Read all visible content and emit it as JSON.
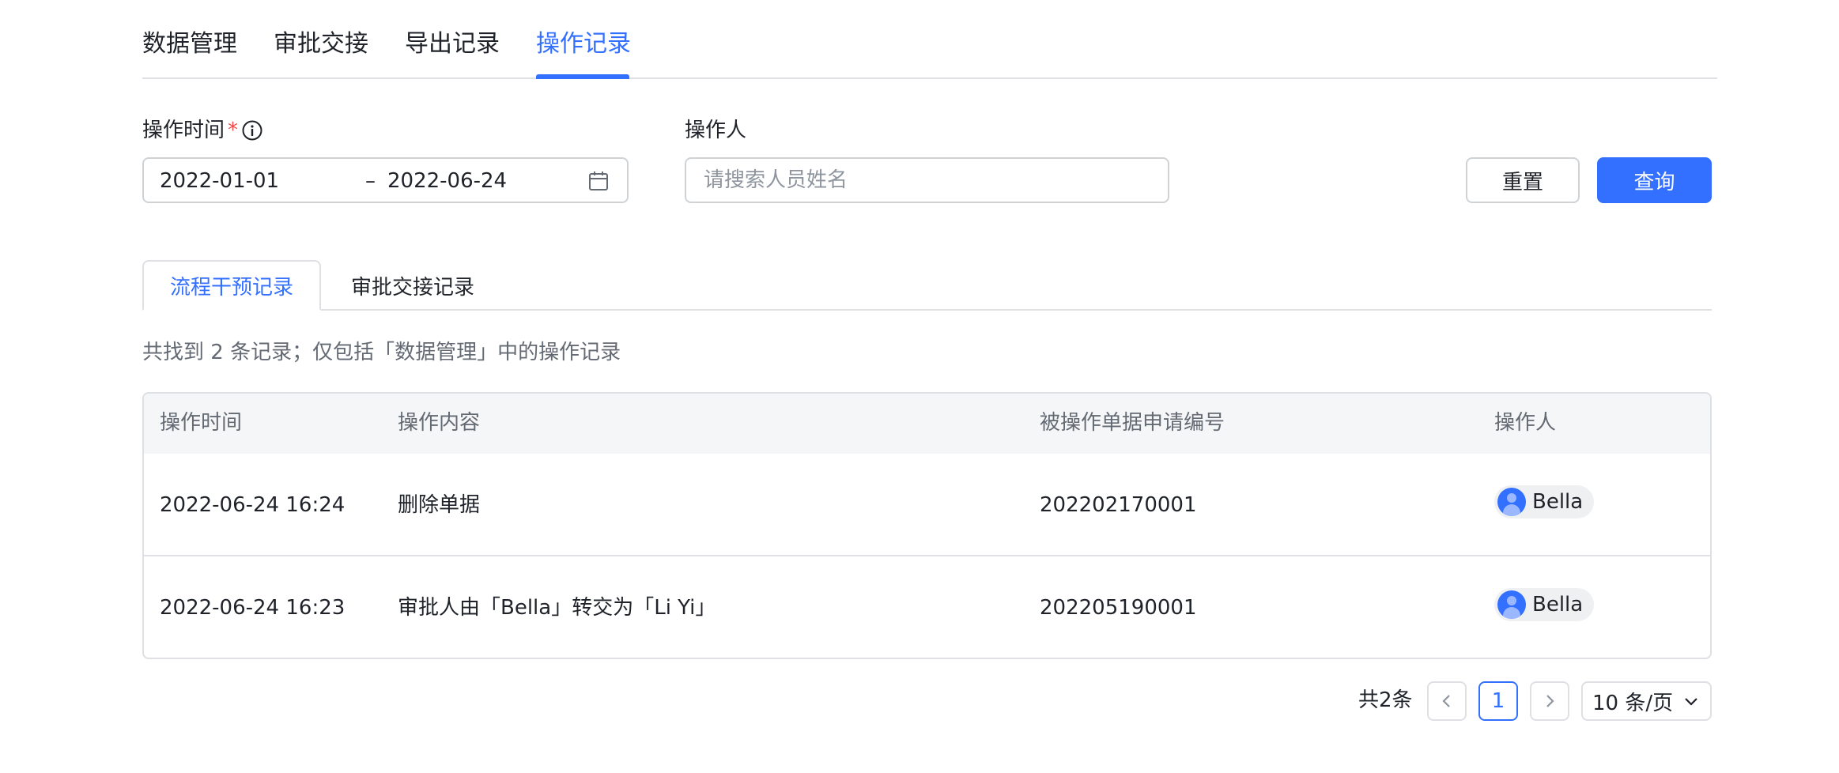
{
  "top_tabs": [
    "数据管理",
    "审批交接",
    "导出记录",
    "操作记录"
  ],
  "active_top_tab": "操作记录",
  "form": {
    "time_label": "操作时间",
    "required_mark": "*",
    "date_start": "2022-01-01",
    "date_separator": "–",
    "date_end": "2022-06-24",
    "operator_label": "操作人",
    "operator_placeholder": "请搜索人员姓名",
    "reset_label": "重置",
    "query_label": "查询"
  },
  "sub_tabs": [
    "流程干预记录",
    "审批交接记录"
  ],
  "summary": "共找到 2 条记录；仅包括「数据管理」中的操作记录",
  "table": {
    "headers": [
      "操作时间",
      "操作内容",
      "被操作单据申请编号",
      "操作人"
    ],
    "rows": [
      {
        "time": "2022-06-24 16:24",
        "content": "删除单据",
        "number": "202202170001",
        "operator": "Bella"
      },
      {
        "time": "2022-06-24 16:23",
        "content": "审批人由「Bella」转交为「Li Yi」",
        "number": "202205190001",
        "operator": "Bella"
      }
    ]
  },
  "pagination": {
    "total": "共2条",
    "current_page": "1",
    "page_size": "10 条/页"
  },
  "colors": {
    "accent": "#3370ff",
    "required": "#f54a45",
    "border": "#dee0e3",
    "header_bg": "#f5f6f7"
  },
  "icons": [
    "info-icon",
    "calendar-icon",
    "chevron-left-icon",
    "chevron-right-icon",
    "chevron-down-icon",
    "avatar"
  ]
}
